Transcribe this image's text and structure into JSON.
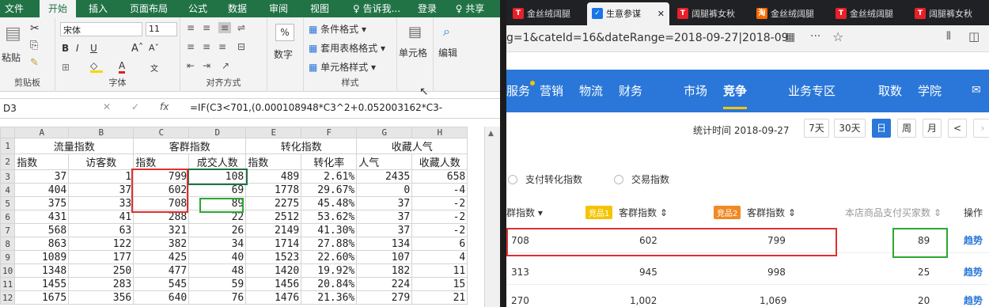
{
  "excel": {
    "tabs": [
      "文件",
      "开始",
      "插入",
      "页面布局",
      "公式",
      "数据",
      "审阅",
      "视图",
      "♀ 告诉我...",
      "登录",
      "♀ 共享"
    ],
    "active_tab": "开始",
    "font_name": "宋体",
    "font_size": "11",
    "paste_label": "粘贴",
    "clipboard_label": "剪贴板",
    "font_group_label": "字体",
    "align_group_label": "对齐方式",
    "number_label": "数字",
    "percent_symbol": "%",
    "style_items": [
      "条件格式 ▾",
      "套用表格格式 ▾",
      "单元格样式 ▾"
    ],
    "style_group_label": "样式",
    "cells_label": "单元格",
    "edit_label": "编辑",
    "name_box": "D3",
    "fx": "fx",
    "formula": "=IF(C3<701,(0.000108948*C3^2+0.052003162*C3-",
    "columns": [
      "A",
      "B",
      "C",
      "D",
      "E",
      "F",
      "G",
      "H"
    ],
    "row_numbers": [
      "1",
      "2",
      "3",
      "4",
      "5",
      "6",
      "7",
      "8",
      "9",
      "10",
      "11",
      "12"
    ],
    "header1": [
      "流量指数",
      "客群指数",
      "转化指数",
      "收藏人气"
    ],
    "header2": [
      "指数",
      "访客数",
      "指数",
      "成交人数",
      "指数",
      "转化率",
      "人气",
      "收藏人数"
    ],
    "rows": [
      [
        "37",
        "1",
        "799",
        "108",
        "489",
        "2.61%",
        "2435",
        "658"
      ],
      [
        "404",
        "37",
        "602",
        "69",
        "1778",
        "29.67%",
        "0",
        "-4"
      ],
      [
        "375",
        "33",
        "708",
        "89",
        "2275",
        "45.48%",
        "37",
        "-2"
      ],
      [
        "431",
        "41",
        "288",
        "22",
        "2512",
        "53.62%",
        "37",
        "-2"
      ],
      [
        "568",
        "63",
        "321",
        "26",
        "2149",
        "41.30%",
        "37",
        "-2"
      ],
      [
        "863",
        "122",
        "382",
        "34",
        "1714",
        "27.88%",
        "134",
        "6"
      ],
      [
        "1089",
        "177",
        "425",
        "40",
        "1523",
        "22.60%",
        "107",
        "4"
      ],
      [
        "1348",
        "250",
        "477",
        "48",
        "1420",
        "19.92%",
        "182",
        "11"
      ],
      [
        "1455",
        "283",
        "545",
        "59",
        "1456",
        "20.84%",
        "224",
        "15"
      ],
      [
        "1675",
        "356",
        "640",
        "76",
        "1476",
        "21.36%",
        "279",
        "21"
      ]
    ]
  },
  "browser": {
    "tabs": [
      {
        "label": "金丝绒阔腿",
        "color": "#e8202a",
        "icon": "T"
      },
      {
        "label": "生意参谋",
        "color": "#1a73e8",
        "icon": "✓"
      },
      {
        "label": "阔腿裤女秋",
        "color": "#e8202a",
        "icon": "T"
      },
      {
        "label": "金丝绒阔腿",
        "color": "#ff6a00",
        "icon": "淘"
      },
      {
        "label": "金丝绒阔腿",
        "color": "#e8202a",
        "icon": "T"
      },
      {
        "label": "阔腿裤女秋",
        "color": "#e8202a",
        "icon": "T"
      }
    ],
    "close_symbol": "✕",
    "url": "g=1&cateId=16&dateRange=2018-09-27|2018-09",
    "nav": [
      "服务",
      "营销",
      "物流",
      "财务",
      "市场",
      "竞争",
      "业务专区",
      "取数",
      "学院"
    ],
    "active_nav": "竞争",
    "stat_time": "统计时间 2018-09-27",
    "ranges": [
      "7天",
      "30天",
      "日",
      "周",
      "月",
      "<"
    ],
    "active_range": "日",
    "radios": [
      "支付转化指数",
      "交易指数"
    ],
    "headers": {
      "col1": "群指数 ▾",
      "badge1": "竞品1",
      "col2": "客群指数 ⇕",
      "badge2": "竞品2",
      "col3": "客群指数 ⇕",
      "col4": "本店商品支付买家数 ⇕",
      "col5": "操作"
    },
    "rows": [
      {
        "a": "708",
        "b": "602",
        "c": "799",
        "d": "89",
        "action": "趋势"
      },
      {
        "a": "313",
        "b": "945",
        "c": "998",
        "d": "25",
        "action": "趋势"
      },
      {
        "a": "270",
        "b": "1,002",
        "c": "1,069",
        "d": "20",
        "action": "趋势"
      }
    ]
  }
}
